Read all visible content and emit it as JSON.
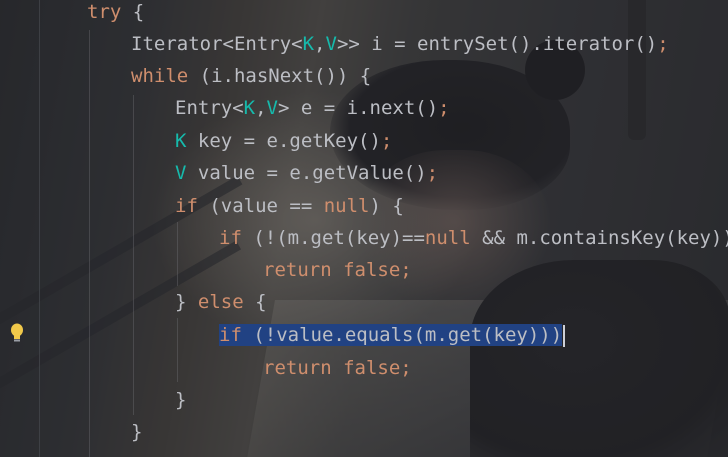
{
  "editor": {
    "lines": [
      {
        "indent": "",
        "tokens": [
          {
            "t": "try",
            "c": "kw"
          },
          {
            "t": " {",
            "c": ""
          }
        ]
      },
      {
        "indent": "",
        "tokens": [
          {
            "t": "Iterator<Entry<",
            "c": ""
          },
          {
            "t": "K",
            "c": "tp"
          },
          {
            "t": ",",
            "c": ""
          },
          {
            "t": "V",
            "c": "tp"
          },
          {
            "t": ">> i = entrySet().iterator()",
            "c": ""
          },
          {
            "t": ";",
            "c": "kw"
          }
        ]
      },
      {
        "indent": "",
        "tokens": [
          {
            "t": "while",
            "c": "kw"
          },
          {
            "t": " (i.hasNext()) {",
            "c": ""
          }
        ]
      },
      {
        "indent": "",
        "tokens": [
          {
            "t": "Entry<",
            "c": ""
          },
          {
            "t": "K",
            "c": "tp"
          },
          {
            "t": ",",
            "c": ""
          },
          {
            "t": "V",
            "c": "tp"
          },
          {
            "t": "> e = i.next()",
            "c": ""
          },
          {
            "t": ";",
            "c": "kw"
          }
        ]
      },
      {
        "indent": "",
        "tokens": [
          {
            "t": "K",
            "c": "tp"
          },
          {
            "t": " key = e.getKey()",
            "c": ""
          },
          {
            "t": ";",
            "c": "kw"
          }
        ]
      },
      {
        "indent": "",
        "tokens": [
          {
            "t": "V",
            "c": "tp"
          },
          {
            "t": " value = e.getValue()",
            "c": ""
          },
          {
            "t": ";",
            "c": "kw"
          }
        ]
      },
      {
        "indent": "",
        "tokens": [
          {
            "t": "if",
            "c": "kw"
          },
          {
            "t": " (value == ",
            "c": ""
          },
          {
            "t": "null",
            "c": "kw"
          },
          {
            "t": ") {",
            "c": ""
          }
        ]
      },
      {
        "indent": "",
        "tokens": [
          {
            "t": "if",
            "c": "kw"
          },
          {
            "t": " (!(m.get(key)==",
            "c": ""
          },
          {
            "t": "null",
            "c": "kw"
          },
          {
            "t": " && m.containsKey(key)))",
            "c": ""
          }
        ]
      },
      {
        "indent": "",
        "tokens": [
          {
            "t": "return false;",
            "c": "kw"
          }
        ]
      },
      {
        "indent": "",
        "tokens": [
          {
            "t": "} ",
            "c": ""
          },
          {
            "t": "else",
            "c": "kw"
          },
          {
            "t": " {",
            "c": ""
          }
        ]
      },
      {
        "indent": "",
        "tokens": [
          {
            "t": "if",
            "c": "kw sel"
          },
          {
            "t": " (!value.equals(m.get(key)))",
            "c": "sel"
          }
        ],
        "caret": true
      },
      {
        "indent": "",
        "tokens": [
          {
            "t": "return false;",
            "c": "kw"
          }
        ]
      },
      {
        "indent": "",
        "tokens": [
          {
            "t": "}",
            "c": ""
          }
        ]
      },
      {
        "indent": "",
        "tokens": [
          {
            "t": "}",
            "c": ""
          }
        ]
      }
    ],
    "intention_icon": "lightbulb-icon"
  },
  "colors": {
    "keyword": "#cf8e6d",
    "type_param": "#16baac",
    "default_text": "#bcbec4",
    "selection": "#214283",
    "bulb": "#f0c84a"
  }
}
